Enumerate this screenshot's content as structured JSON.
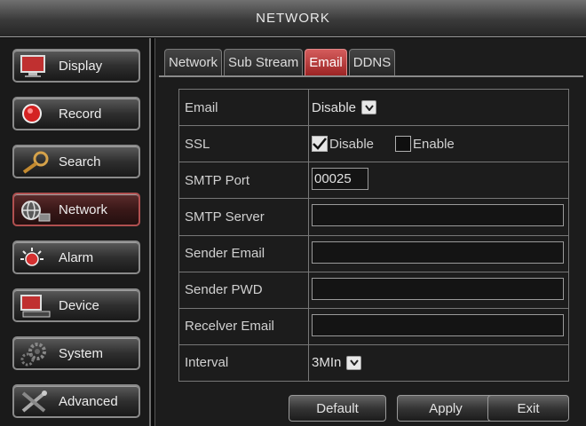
{
  "window": {
    "title": "NETWORK"
  },
  "sidebar": {
    "items": [
      {
        "label": "Display",
        "icon": "monitor-icon"
      },
      {
        "label": "Record",
        "icon": "record-icon"
      },
      {
        "label": "Search",
        "icon": "magnifier-icon"
      },
      {
        "label": "Network",
        "icon": "network-globe-icon",
        "active": true
      },
      {
        "label": "Alarm",
        "icon": "alarm-icon"
      },
      {
        "label": "Device",
        "icon": "device-icon"
      },
      {
        "label": "System",
        "icon": "gears-icon"
      },
      {
        "label": "Advanced",
        "icon": "tools-icon"
      }
    ]
  },
  "tabs": [
    {
      "label": "Network"
    },
    {
      "label": "Sub Stream"
    },
    {
      "label": "Email",
      "active": true
    },
    {
      "label": "DDNS"
    }
  ],
  "form": {
    "email": {
      "label": "Email",
      "value": "Disable"
    },
    "ssl": {
      "label": "SSL",
      "options": [
        {
          "label": "Disable",
          "checked": true
        },
        {
          "label": "Enable",
          "checked": false
        }
      ]
    },
    "smtp_port": {
      "label": "SMTP Port",
      "value": "00025"
    },
    "smtp_server": {
      "label": "SMTP Server",
      "value": ""
    },
    "sender_email": {
      "label": "Sender Email",
      "value": ""
    },
    "sender_pwd": {
      "label": "Sender PWD",
      "value": ""
    },
    "receiver_email": {
      "label": "Recelver Email",
      "value": ""
    },
    "interval": {
      "label": "Interval",
      "value": "3MIn"
    }
  },
  "buttons": {
    "default": "Default",
    "apply": "Apply",
    "exit": "Exit"
  },
  "colors": {
    "active_tab": "#c43c3c",
    "active_menu_border": "#b05050",
    "background": "#1c1c1c"
  }
}
